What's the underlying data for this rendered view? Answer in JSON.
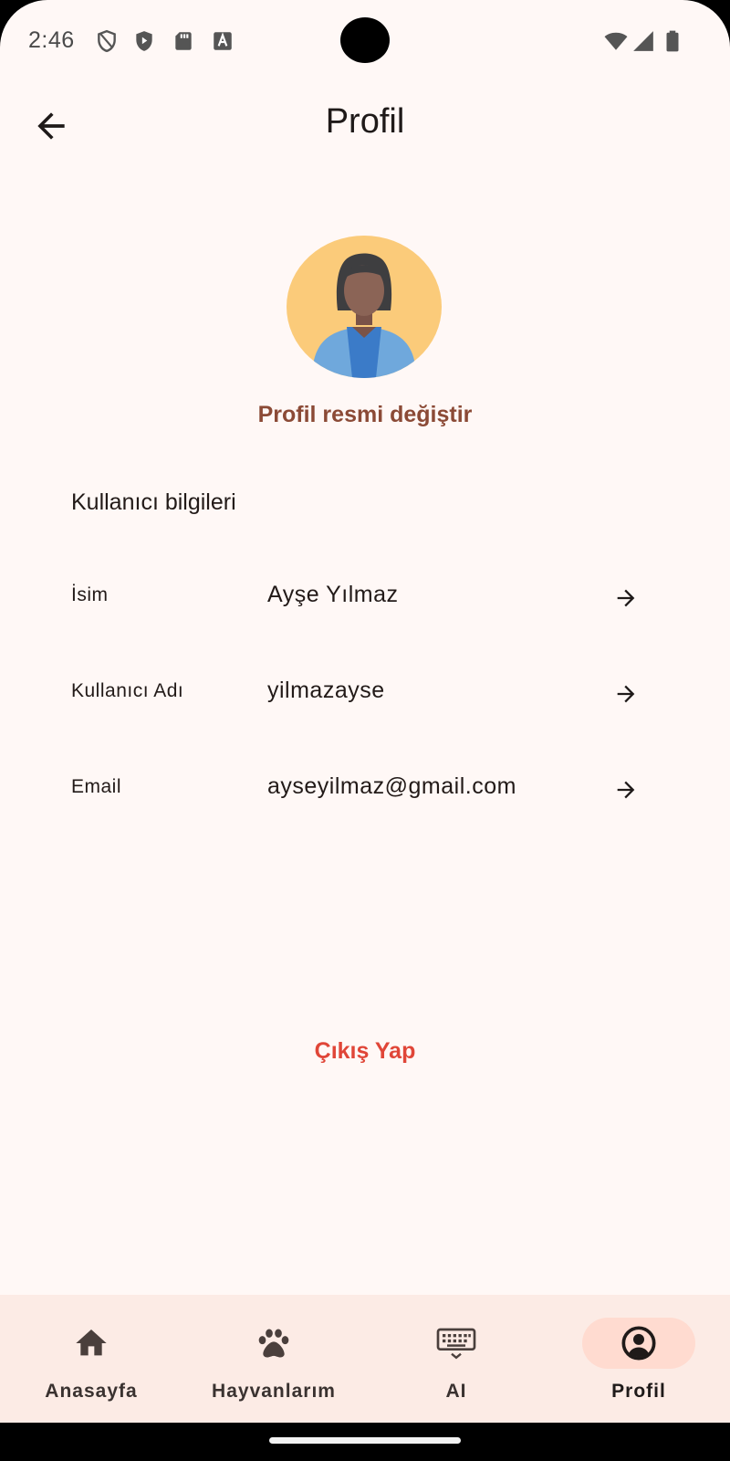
{
  "status_bar": {
    "time": "2:46",
    "icons": [
      "shield-outline-icon",
      "shield-play-icon",
      "sd-card-icon",
      "font-a-icon",
      "wifi-icon",
      "cellular-signal-icon",
      "battery-icon"
    ]
  },
  "app_bar": {
    "title": "Profil",
    "back_icon": "arrow-back-icon"
  },
  "profile": {
    "avatar_icon": "woman-avatar",
    "change_photo_label": "Profil resmi değiştir"
  },
  "user_info": {
    "section_title": "Kullanıcı bilgileri",
    "rows": [
      {
        "label": "İsim",
        "value": "Ayşe Yılmaz"
      },
      {
        "label": "Kullanıcı Adı",
        "value": "yilmazayse"
      },
      {
        "label": "Email",
        "value": "ayseyilmaz@gmail.com"
      }
    ]
  },
  "logout_label": "Çıkış Yap",
  "bottom_nav": {
    "items": [
      {
        "label": "Anasayfa",
        "icon": "home-icon",
        "active": false
      },
      {
        "label": "Hayvanlarım",
        "icon": "paw-icon",
        "active": false
      },
      {
        "label": "AI",
        "icon": "keyboard-icon",
        "active": false
      },
      {
        "label": "Profil",
        "icon": "account-circle-icon",
        "active": true
      }
    ]
  },
  "colors": {
    "background": "#FFF8F6",
    "accent_brown": "#8B4A36",
    "logout_red": "#E04638",
    "nav_background": "#FCEBE5",
    "nav_active_pill": "#FFDBD0",
    "avatar_background": "#FBCB7A"
  }
}
